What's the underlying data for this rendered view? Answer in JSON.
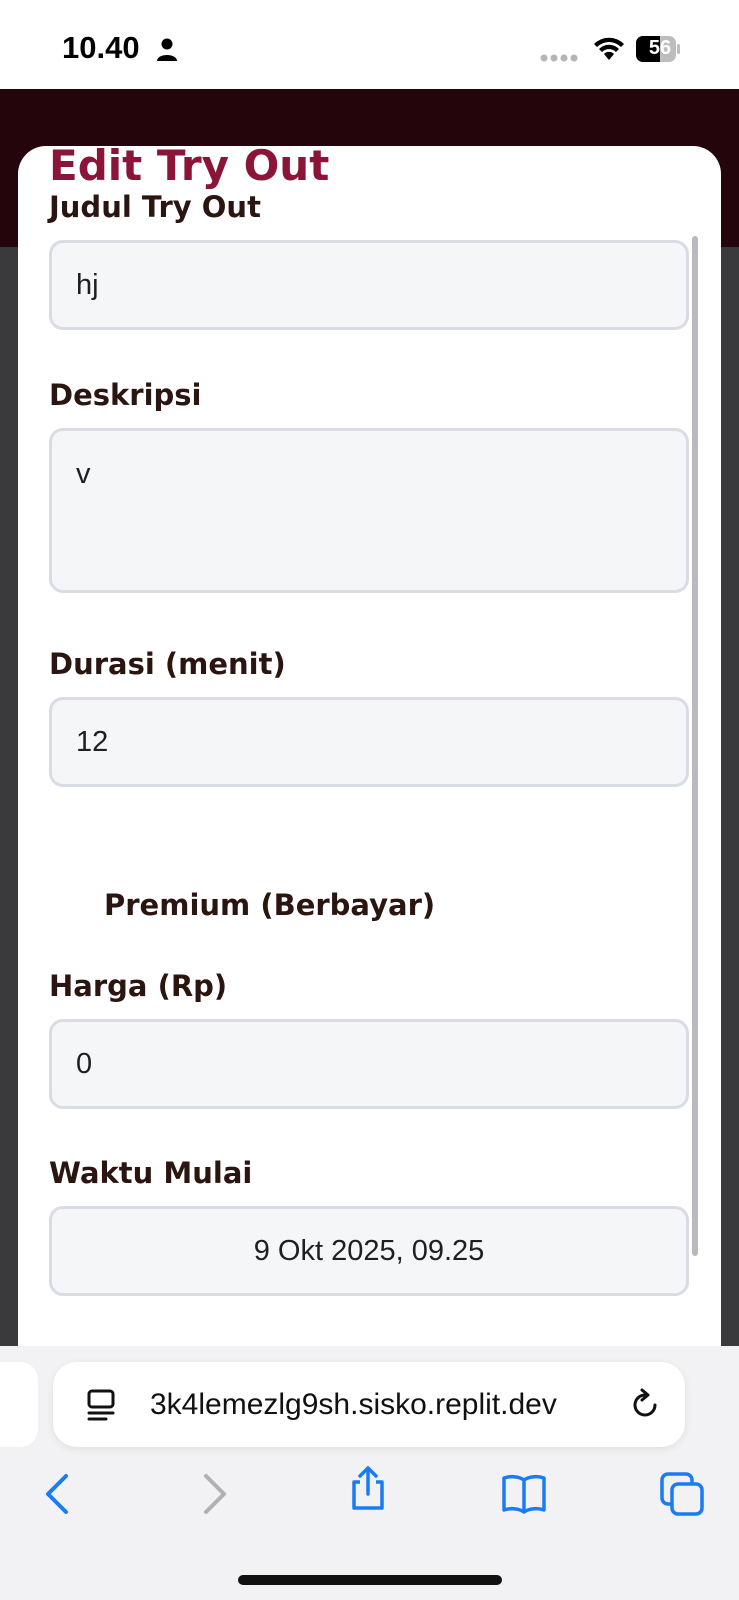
{
  "status_bar": {
    "time": "10.40",
    "battery": "56"
  },
  "modal": {
    "title": "Edit Try Out",
    "fields": {
      "judul": {
        "label": "Judul Try Out",
        "value": "hj"
      },
      "deskripsi": {
        "label": "Deskripsi",
        "value": "v"
      },
      "durasi": {
        "label": "Durasi (menit)",
        "value": "12"
      },
      "premium": {
        "label": "Premium (Berbayar)"
      },
      "harga": {
        "label": "Harga (Rp)",
        "value": "0"
      },
      "waktu_mulai": {
        "label": "Waktu Mulai",
        "value": "9 Okt 2025, 09.25"
      }
    }
  },
  "browser": {
    "url": "3k4lemezlg9sh.sisko.replit.dev",
    "accent_color": "#1a7cf5"
  },
  "colors": {
    "title": "#8b1538",
    "label": "#2a1510",
    "header": "#25050c"
  }
}
